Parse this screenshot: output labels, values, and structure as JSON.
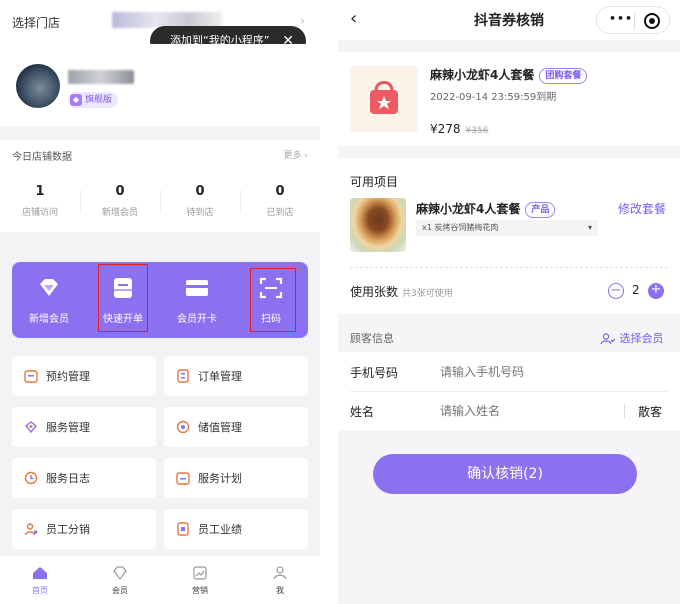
{
  "left": {
    "store_select": "选择门店",
    "tooltip": "添加到“我的小程序”",
    "badge": "旗舰版",
    "stats": {
      "title": "今日店铺数据",
      "more": "更多",
      "items": [
        {
          "value": "1",
          "label": "店铺访问"
        },
        {
          "value": "0",
          "label": "新增会员"
        },
        {
          "value": "0",
          "label": "待到店"
        },
        {
          "value": "0",
          "label": "已到店"
        }
      ]
    },
    "quick": [
      {
        "label": "新增会员",
        "icon": "diamond-icon"
      },
      {
        "label": "快速开单",
        "icon": "inbox-icon"
      },
      {
        "label": "会员开卡",
        "icon": "card-icon"
      },
      {
        "label": "扫码",
        "icon": "scan-icon"
      }
    ],
    "menu": [
      {
        "label": "预约管理",
        "icon": "calendar-icon"
      },
      {
        "label": "订单管理",
        "icon": "order-icon"
      },
      {
        "label": "服务管理",
        "icon": "service-icon"
      },
      {
        "label": "储值管理",
        "icon": "wallet-icon"
      },
      {
        "label": "服务日志",
        "icon": "log-icon"
      },
      {
        "label": "服务计划",
        "icon": "plan-icon"
      },
      {
        "label": "员工分销",
        "icon": "staff-icon"
      },
      {
        "label": "员工业绩",
        "icon": "performance-icon"
      }
    ],
    "tabs": [
      {
        "label": "首页",
        "active": true
      },
      {
        "label": "会员",
        "active": false
      },
      {
        "label": "营销",
        "active": false
      },
      {
        "label": "我",
        "active": false
      }
    ]
  },
  "right": {
    "title": "抖音券核销",
    "product": {
      "name": "麻辣小龙虾4人套餐",
      "tag": "团购套餐",
      "expiry": "2022-09-14 23:59:59到期",
      "price": "¥278",
      "original_price": "¥356"
    },
    "available_title": "可用项目",
    "item": {
      "name": "麻辣小龙虾4人套餐",
      "tag": "产品",
      "modify": "修改套餐",
      "option": "x1 炭烤谷饲猪梅花肉"
    },
    "usage": {
      "label": "使用张数",
      "hint": "共3张可使用",
      "count": "2"
    },
    "customer": {
      "title": "顾客信息",
      "select_member": "选择会员",
      "phone_label": "手机号码",
      "phone_placeholder": "请输入手机号码",
      "name_label": "姓名",
      "name_placeholder": "请输入姓名",
      "walkin": "散客"
    },
    "confirm": "确认核销(2)"
  },
  "colors": {
    "accent": "#8b70f0",
    "highlight_box": "#e11d2a",
    "tag": "#7b5cf0"
  }
}
